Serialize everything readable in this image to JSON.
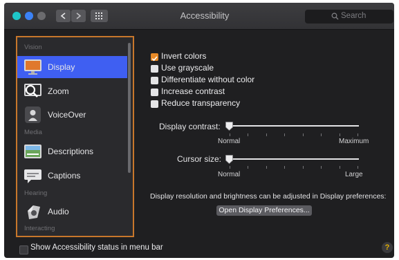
{
  "window": {
    "title": "Accessibility",
    "search_placeholder": "Search",
    "traffic_lights": [
      "#1ec6c8",
      "#3b82f6",
      "#6b6b6e"
    ]
  },
  "sidebar": {
    "sections": {
      "vision": "Vision",
      "media": "Media",
      "hearing": "Hearing",
      "interacting": "Interacting"
    },
    "items": [
      {
        "label": "Display",
        "icon": "display-icon",
        "selected": true
      },
      {
        "label": "Zoom",
        "icon": "zoom-icon"
      },
      {
        "label": "VoiceOver",
        "icon": "voiceover-icon"
      },
      {
        "label": "Descriptions",
        "icon": "descriptions-icon"
      },
      {
        "label": "Captions",
        "icon": "captions-icon"
      },
      {
        "label": "Audio",
        "icon": "audio-icon"
      }
    ],
    "highlight_color": "#c8772b",
    "selection_color": "#3f5ff2"
  },
  "options": [
    {
      "label": "Invert colors",
      "checked": true
    },
    {
      "label": "Use grayscale",
      "checked": false
    },
    {
      "label": "Differentiate without color",
      "checked": false
    },
    {
      "label": "Increase contrast",
      "checked": false
    },
    {
      "label": "Reduce transparency",
      "checked": false
    }
  ],
  "contrast": {
    "label": "Display contrast:",
    "min": "Normal",
    "max": "Maximum",
    "value": 0
  },
  "cursor": {
    "label": "Cursor size:",
    "min": "Normal",
    "max": "Large",
    "value": 0
  },
  "note": "Display resolution and brightness can be adjusted in Display preferences:",
  "open_button": "Open Display Preferences...",
  "footer": {
    "show_status": "Show Accessibility status in menu bar",
    "show_status_checked": false,
    "help": "?"
  },
  "accent": "#e88a27"
}
